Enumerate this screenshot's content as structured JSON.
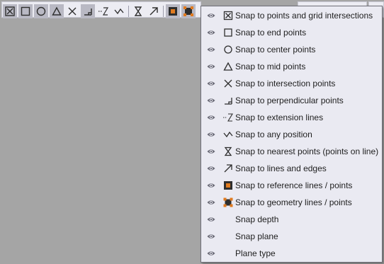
{
  "toolbar": {
    "buttons": [
      {
        "icon": "snap-points-grid-icon"
      },
      {
        "icon": "snap-end-points-icon"
      },
      {
        "icon": "snap-center-points-icon"
      },
      {
        "icon": "snap-mid-points-icon"
      },
      {
        "icon": "snap-intersection-icon"
      },
      {
        "icon": "snap-perpendicular-icon"
      },
      {
        "icon": "snap-extension-icon"
      },
      {
        "icon": "snap-any-position-icon"
      },
      {
        "icon": "snap-nearest-icon"
      },
      {
        "icon": "snap-lines-edges-icon"
      },
      {
        "icon": "snap-reference-lines-icon"
      },
      {
        "icon": "snap-geometry-lines-icon"
      }
    ]
  },
  "menu": {
    "items": [
      {
        "label": "Snap to points and grid intersections",
        "icon": "snap-points-grid-icon"
      },
      {
        "label": "Snap to end points",
        "icon": "snap-end-points-icon"
      },
      {
        "label": "Snap to center points",
        "icon": "snap-center-points-icon"
      },
      {
        "label": "Snap to mid points",
        "icon": "snap-mid-points-icon"
      },
      {
        "label": "Snap to intersection points",
        "icon": "snap-intersection-icon"
      },
      {
        "label": "Snap to perpendicular points",
        "icon": "snap-perpendicular-icon"
      },
      {
        "label": "Snap to extension lines",
        "icon": "snap-extension-icon"
      },
      {
        "label": "Snap to any position",
        "icon": "snap-any-position-icon"
      },
      {
        "label": "Snap to nearest points (points on line)",
        "icon": "snap-nearest-icon"
      },
      {
        "label": "Snap to lines and edges",
        "icon": "snap-lines-edges-icon"
      },
      {
        "label": "Snap to reference lines / points",
        "icon": "snap-reference-lines-icon"
      },
      {
        "label": "Snap to geometry lines / points",
        "icon": "snap-geometry-lines-icon"
      },
      {
        "label": "Snap depth",
        "icon": ""
      },
      {
        "label": "Snap plane",
        "icon": ""
      },
      {
        "label": "Plane type",
        "icon": ""
      }
    ],
    "visibility_icon": "eye-icon"
  },
  "colors": {
    "workspace": "#a5a5a5",
    "menu_bg": "#eaeaf2",
    "accent_orange": "#e07a1f",
    "icon_dark": "#2e2e2e"
  }
}
